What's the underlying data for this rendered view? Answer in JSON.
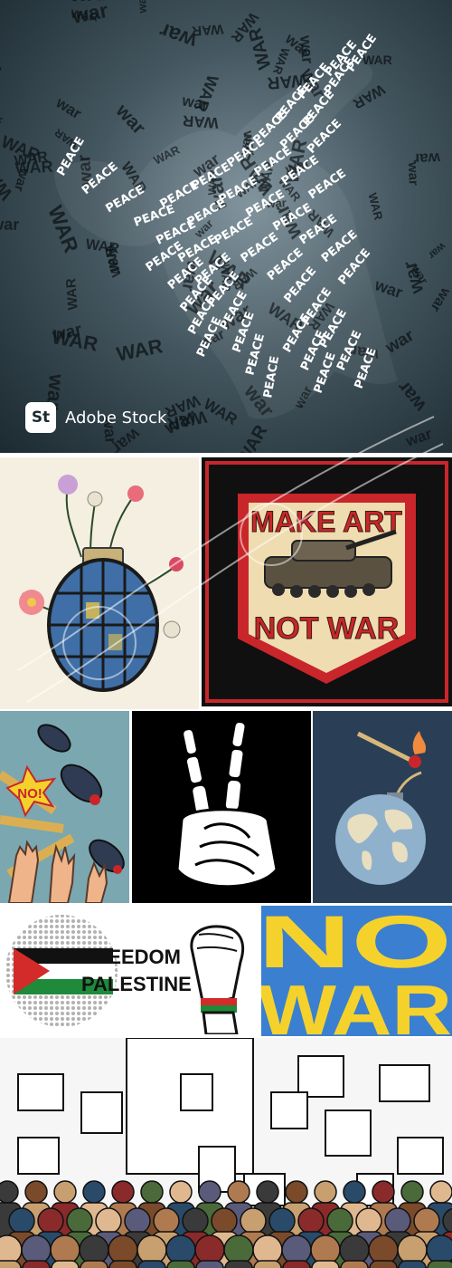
{
  "tile1": {
    "background_word": "WAR",
    "background_word_lower": "war",
    "dove_word": "PEACE",
    "badge_icon_text": "St",
    "badge_label": "Adobe Stock"
  },
  "tile3": {
    "line1": "MAKE ART",
    "line2": "NOT WAR"
  },
  "tile4": {
    "burst_text": "NO!"
  },
  "tile7": {
    "line1": "FREEDOM",
    "line2": "PALESTINE"
  },
  "tile8": {
    "line1": "NO",
    "line2": "WAR"
  },
  "colors": {
    "peace_white": "#ffffff",
    "war_dark": "#0e1518",
    "art_red": "#c8262b",
    "art_cream": "#efdcb0",
    "ukraine_blue": "#3b7fd1",
    "ukraine_yellow": "#f5d22b",
    "palestine_green": "#1f8a3a",
    "palestine_red": "#d32a2a"
  }
}
